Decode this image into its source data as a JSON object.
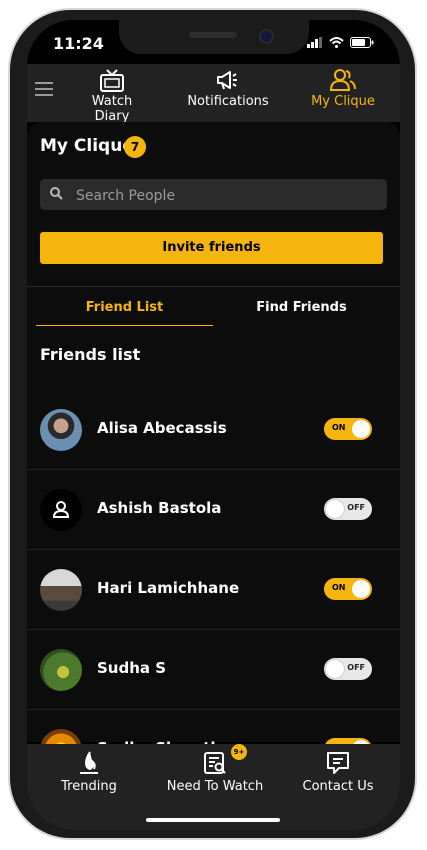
{
  "status_bar": {
    "time": "11:24"
  },
  "top_tabs": [
    {
      "label": "Watch Diary",
      "icon": "tv-icon"
    },
    {
      "label": "Notifications",
      "icon": "megaphone-icon"
    },
    {
      "label": "My Clique",
      "icon": "group-icon"
    }
  ],
  "page": {
    "title": "My Clique",
    "badge_count": "7",
    "search_placeholder": "Search People",
    "invite_label": "Invite friends",
    "tabs": [
      "Friend List",
      "Find Friends"
    ],
    "section_title": "Friends list"
  },
  "friends": [
    {
      "name": "Alisa Abecassis",
      "toggle": "ON"
    },
    {
      "name": "Ashish Bastola",
      "toggle": "OFF"
    },
    {
      "name": "Hari Lamichhane",
      "toggle": "ON"
    },
    {
      "name": "Sudha S",
      "toggle": "OFF"
    },
    {
      "name": "Sudha Shrestha",
      "toggle": "ON"
    }
  ],
  "bottom_tabs": [
    {
      "label": "Trending",
      "icon": "flame-icon"
    },
    {
      "label": "Need To Watch",
      "icon": "list-search-icon",
      "badge": "9+"
    },
    {
      "label": "Contact Us",
      "icon": "chat-icon"
    }
  ],
  "colors": {
    "accent": "#f5b50d",
    "background": "#000000",
    "bar": "#222222"
  }
}
